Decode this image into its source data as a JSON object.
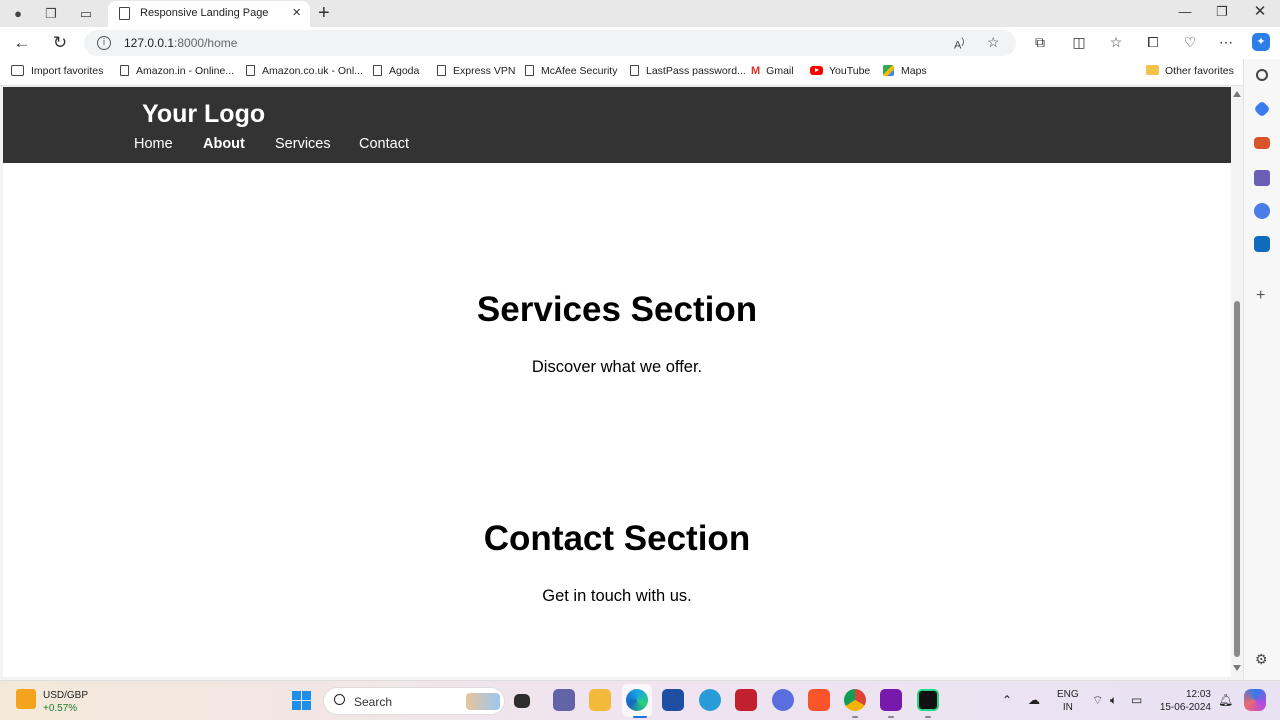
{
  "browser": {
    "tab_title": "Responsive Landing Page",
    "url_host": "127.0.0.1",
    "url_path": ":8000/home"
  },
  "bookmarks": [
    {
      "label": "Import favorites"
    },
    {
      "label": "Amazon.in - Online..."
    },
    {
      "label": "Amazon.co.uk - Onl..."
    },
    {
      "label": "Agoda"
    },
    {
      "label": "Express VPN"
    },
    {
      "label": "McAfee Security"
    },
    {
      "label": "LastPass password..."
    },
    {
      "label": "Gmail"
    },
    {
      "label": "YouTube"
    },
    {
      "label": "Maps"
    },
    {
      "label": "Other favorites"
    }
  ],
  "site": {
    "logo": "Your Logo",
    "nav": [
      "Home",
      "About",
      "Services",
      "Contact"
    ],
    "active_nav": "About",
    "header_bg": "#333333"
  },
  "sections": [
    {
      "title": "Services Section",
      "text": "Discover what we offer."
    },
    {
      "title": "Contact Section",
      "text": "Get in touch with us."
    }
  ],
  "taskbar": {
    "ticker_name": "USD/GBP",
    "ticker_change": "+0.57%",
    "search_placeholder": "Search",
    "lang_1": "ENG",
    "lang_2": "IN",
    "time": "12:03",
    "date": "15-06-2024"
  }
}
